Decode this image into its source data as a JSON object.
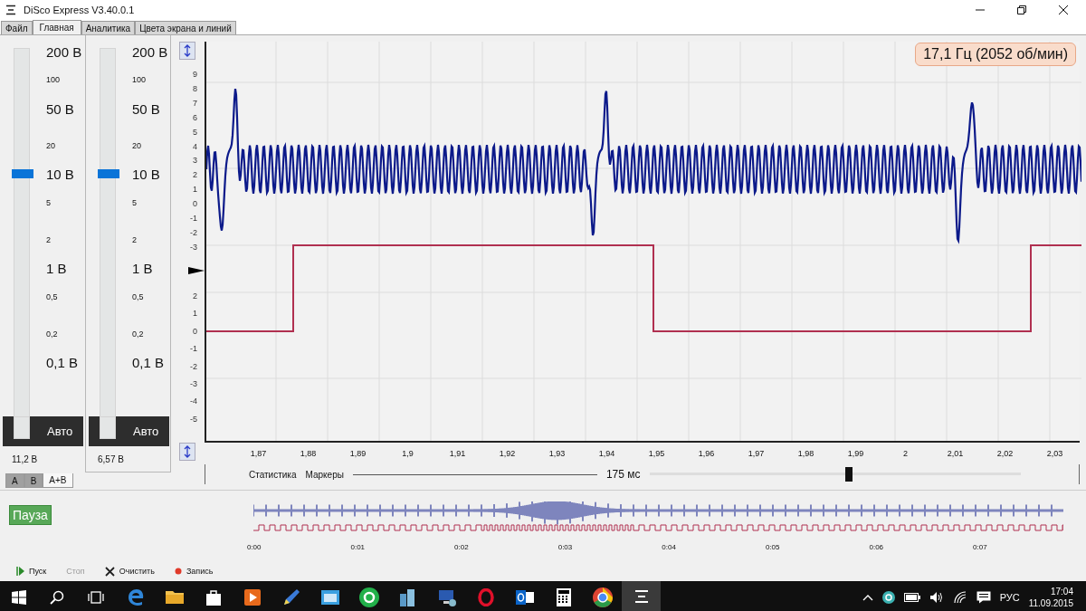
{
  "window": {
    "title": "DiSco Express V3.40.0.1"
  },
  "menu_tabs": [
    {
      "label": "Файл",
      "selected": false
    },
    {
      "label": "Главная",
      "selected": true
    },
    {
      "label": "Аналитика",
      "selected": false
    },
    {
      "label": "Цвета экрана и линий",
      "selected": false
    }
  ],
  "channels": [
    {
      "scale": [
        {
          "label": "200 В",
          "kind": "major"
        },
        {
          "label": "100",
          "kind": "minor"
        },
        {
          "label": "50 В",
          "kind": "major"
        },
        {
          "label": "20",
          "kind": "minor"
        },
        {
          "label": "10 В",
          "kind": "major"
        },
        {
          "label": "5",
          "kind": "minor"
        },
        {
          "label": "2",
          "kind": "minor"
        },
        {
          "label": "1 В",
          "kind": "major"
        },
        {
          "label": "0,5",
          "kind": "minor"
        },
        {
          "label": "0,2",
          "kind": "minor"
        },
        {
          "label": "0,1 В",
          "kind": "major"
        }
      ],
      "level": 0.68,
      "mode": "Авто",
      "reading": "11,2 В"
    },
    {
      "scale": [
        {
          "label": "200 В",
          "kind": "major"
        },
        {
          "label": "100",
          "kind": "minor"
        },
        {
          "label": "50 В",
          "kind": "major"
        },
        {
          "label": "20",
          "kind": "minor"
        },
        {
          "label": "10 В",
          "kind": "major"
        },
        {
          "label": "5",
          "kind": "minor"
        },
        {
          "label": "2",
          "kind": "minor"
        },
        {
          "label": "1 В",
          "kind": "major"
        },
        {
          "label": "0,5",
          "kind": "minor"
        },
        {
          "label": "0,2",
          "kind": "minor"
        },
        {
          "label": "0,1 В",
          "kind": "major"
        }
      ],
      "level": 0.68,
      "mode": "Авто",
      "reading": "6,57 В"
    }
  ],
  "channel_tabs": [
    {
      "label": "A",
      "selected": false
    },
    {
      "label": "B",
      "selected": false
    },
    {
      "label": "A+B",
      "selected": true
    }
  ],
  "scope": {
    "frequency": "17,1 Гц (2052 об/мин)",
    "upper_axis": [
      "9",
      "8",
      "7",
      "6",
      "5",
      "4",
      "3",
      "2",
      "1",
      "0",
      "-1",
      "-2",
      "-3"
    ],
    "lower_axis": [
      "2",
      "1",
      "0",
      "-1",
      "-2",
      "-3",
      "-4",
      "-5"
    ],
    "x_axis": [
      "1,87",
      "1,88",
      "1,89",
      "1,9",
      "1,91",
      "1,92",
      "1,93",
      "1,94",
      "1,95",
      "1,96",
      "1,97",
      "1,98",
      "1,99",
      "2",
      "2,01",
      "2,02",
      "2,03"
    ],
    "statistics_tab": "Статистика",
    "markers_tab": "Маркеры",
    "span": "175 мс"
  },
  "overview": {
    "pause_button": "Пауза",
    "time_ticks": [
      "0:00",
      "0:01",
      "0:02",
      "0:03",
      "0:04",
      "0:05",
      "0:06",
      "0:07"
    ]
  },
  "controls": [
    {
      "label": "Пуск",
      "kind": "play",
      "disabled": false
    },
    {
      "label": "Стоп",
      "kind": "stop",
      "disabled": true
    },
    {
      "label": "Очистить",
      "kind": "clear",
      "disabled": false
    },
    {
      "label": "Запись",
      "kind": "record",
      "disabled": false
    }
  ],
  "taskbar": {
    "apps": [
      {
        "kind": "edge",
        "selected": false
      },
      {
        "kind": "folder",
        "selected": false
      },
      {
        "kind": "store",
        "selected": false
      },
      {
        "kind": "media",
        "selected": false
      },
      {
        "kind": "pencil",
        "selected": false
      },
      {
        "kind": "window",
        "selected": false
      },
      {
        "kind": "ring",
        "selected": false
      },
      {
        "kind": "buildings",
        "selected": false
      },
      {
        "kind": "monitor",
        "selected": false
      },
      {
        "kind": "opera",
        "selected": false
      },
      {
        "kind": "envelope",
        "selected": false
      },
      {
        "kind": "calculator",
        "selected": false
      },
      {
        "kind": "chrome",
        "selected": false
      },
      {
        "kind": "logo",
        "selected": true
      }
    ],
    "language": "РУС",
    "time": "17:04",
    "date": "11.09.2015"
  }
}
